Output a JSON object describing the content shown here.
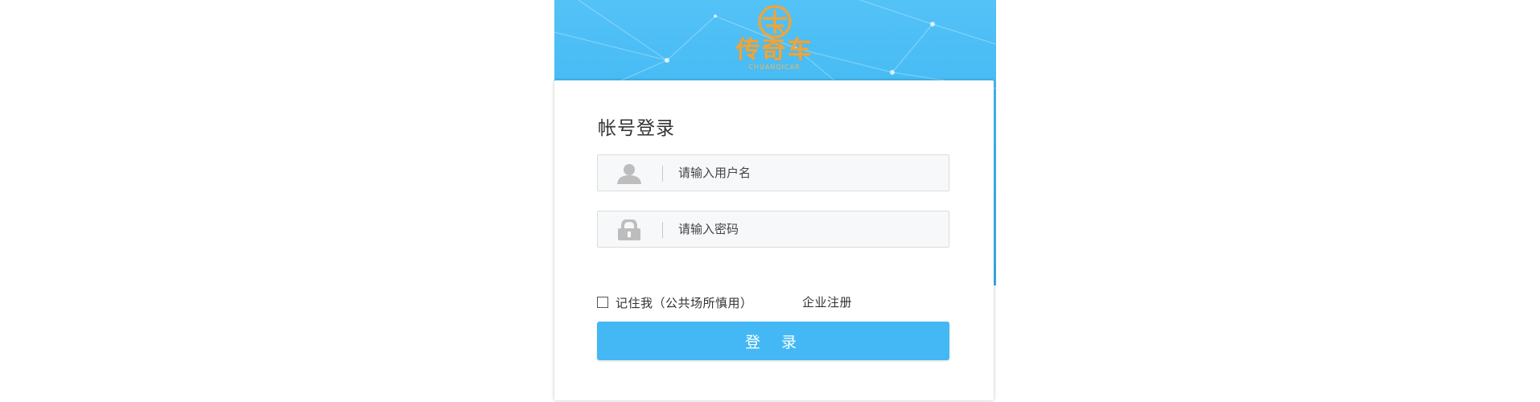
{
  "brand": {
    "name": "传奇车",
    "subname": "CHUANQICAR",
    "color": "#e9a640",
    "background": "#43b8f4"
  },
  "login": {
    "title": "帐号登录",
    "username_placeholder": "请输入用户名",
    "username_value": "",
    "password_placeholder": "请输入密码",
    "password_value": "",
    "remember_label": "记住我（公共场所慎用）",
    "remember_checked": false,
    "register_link": "企业注册",
    "submit_label": "登 录"
  },
  "icons": {
    "username": "user-icon",
    "password": "lock-icon"
  }
}
